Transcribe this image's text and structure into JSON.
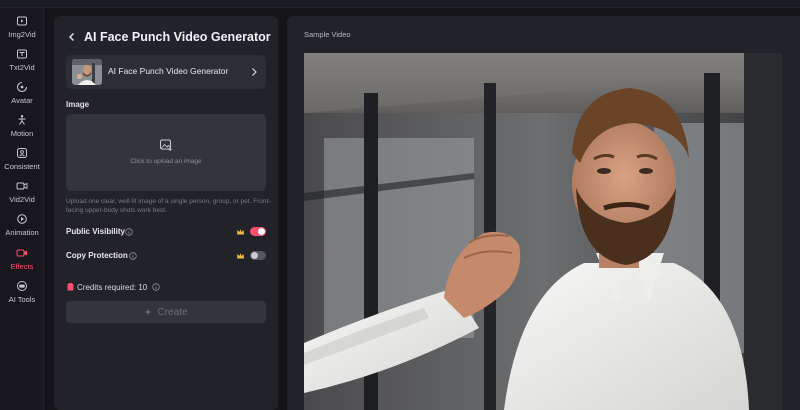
{
  "sidebar": {
    "items": [
      {
        "label": "Img2Vid",
        "icon": "image-to-video-icon",
        "active": false
      },
      {
        "label": "Txt2Vid",
        "icon": "text-to-video-icon",
        "active": false
      },
      {
        "label": "Avatar",
        "icon": "avatar-icon",
        "active": false
      },
      {
        "label": "Motion",
        "icon": "motion-icon",
        "active": false
      },
      {
        "label": "Consistent",
        "icon": "consistent-icon",
        "active": false
      },
      {
        "label": "Vid2Vid",
        "icon": "video-to-video-icon",
        "active": false
      },
      {
        "label": "Animation",
        "icon": "animation-icon",
        "active": false
      },
      {
        "label": "Effects",
        "icon": "effects-icon",
        "active": true
      },
      {
        "label": "AI Tools",
        "icon": "ai-tools-icon",
        "active": false
      }
    ]
  },
  "panel": {
    "title": "AI Face Punch Video Generator",
    "template": {
      "label": "AI Face Punch Video Generator"
    },
    "image_section": {
      "label": "Image",
      "upload_text": "Click to upload an image",
      "help_text": "Upload one clear, well-lit image of a single person, group, or pet. Front-facing upper-body shots work best."
    },
    "options": [
      {
        "label": "Public Visibility",
        "enabled": true
      },
      {
        "label": "Copy Protection",
        "enabled": false
      }
    ],
    "credits": "Credits required: 10",
    "create_label": "Create"
  },
  "preview": {
    "label": "Sample Video"
  },
  "colors": {
    "accent": "#ff4d6d",
    "background": "#141419",
    "panel": "#222229"
  }
}
